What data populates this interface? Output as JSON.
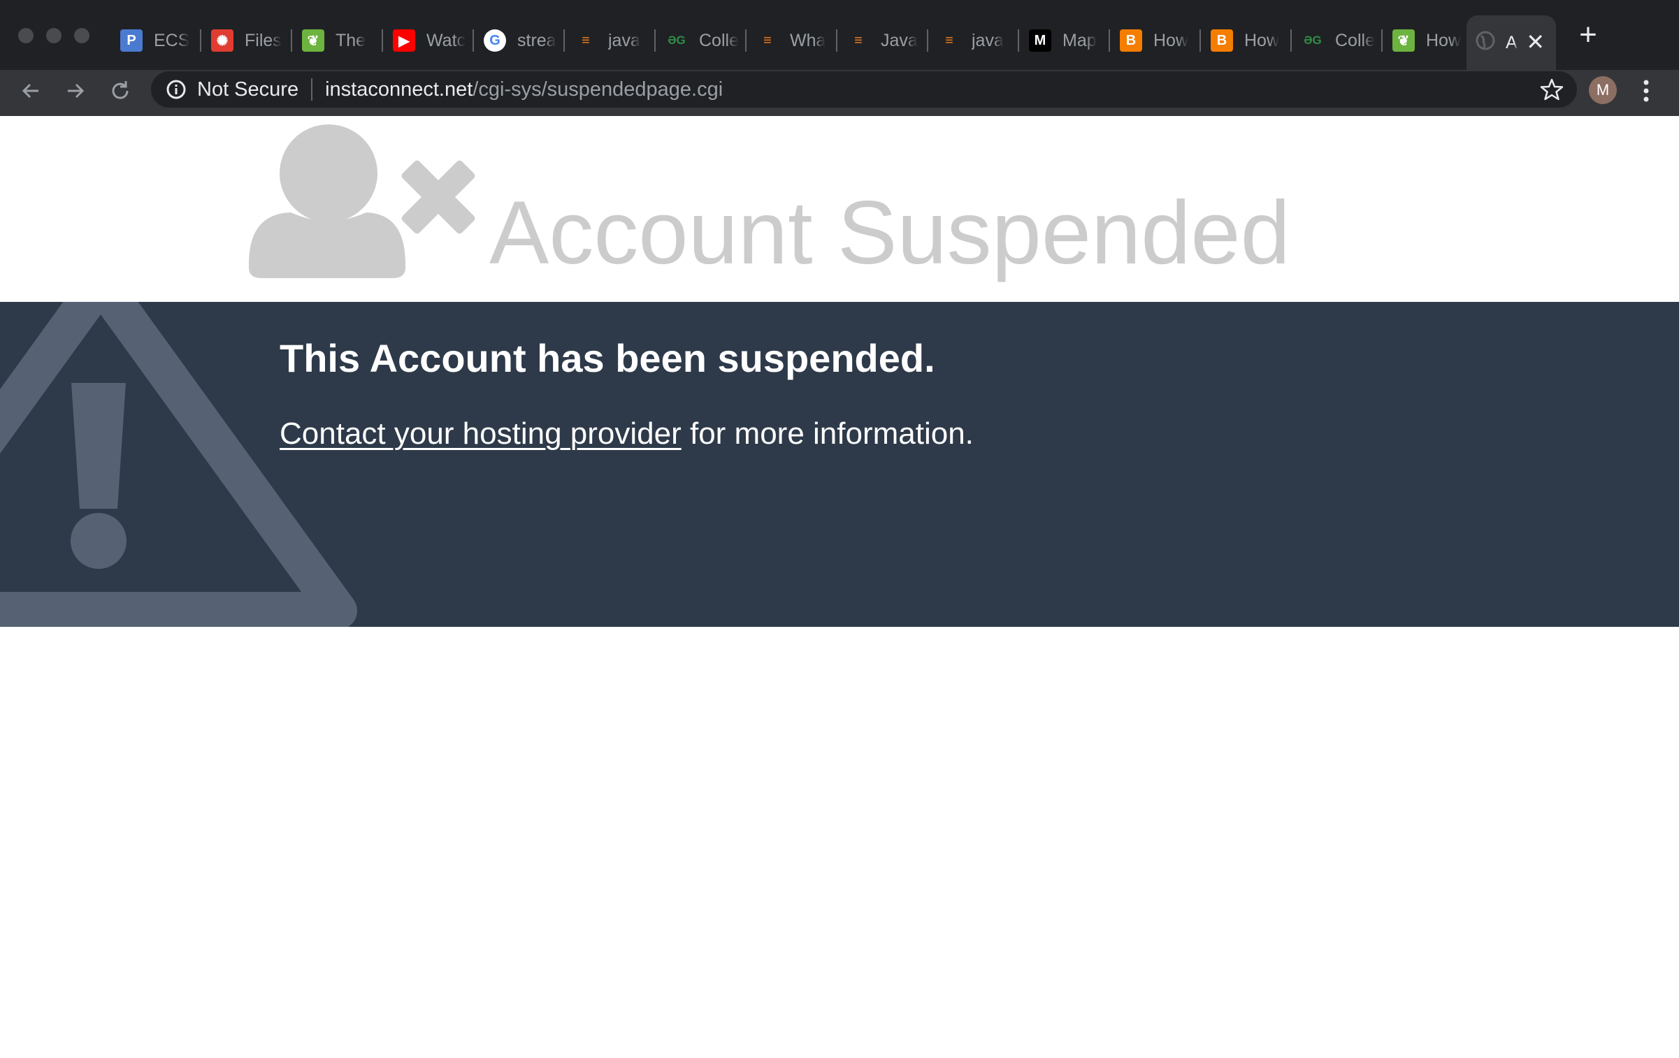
{
  "browser": {
    "tabs": [
      {
        "label": "ECS",
        "icon": "pluralsight-icon",
        "icon_bg": "#4a7bd0",
        "glyph": "P"
      },
      {
        "label": "Files",
        "icon": "canvas-icon",
        "icon_bg": "#e03c31",
        "glyph": "✺"
      },
      {
        "label": "The",
        "icon": "leaf-icon",
        "icon_bg": "#6db33f",
        "glyph": "❦"
      },
      {
        "label": "Watc",
        "icon": "youtube-icon",
        "icon_bg": "#ff0000",
        "glyph": "▶"
      },
      {
        "label": "strea",
        "icon": "google-icon",
        "icon_bg": "#ffffff",
        "glyph": "G"
      },
      {
        "label": "java",
        "icon": "stackoverflow-icon",
        "icon_bg": "transparent",
        "glyph": "≡"
      },
      {
        "label": "Colle",
        "icon": "geeksforgeeks-icon",
        "icon_bg": "transparent",
        "glyph": "ƏG"
      },
      {
        "label": "Wha",
        "icon": "stackoverflow-icon",
        "icon_bg": "transparent",
        "glyph": "≡"
      },
      {
        "label": "Java",
        "icon": "stackoverflow-icon",
        "icon_bg": "transparent",
        "glyph": "≡"
      },
      {
        "label": "java",
        "icon": "stackoverflow-icon",
        "icon_bg": "transparent",
        "glyph": "≡"
      },
      {
        "label": "Map",
        "icon": "medium-icon",
        "icon_bg": "#000000",
        "glyph": "M"
      },
      {
        "label": "How",
        "icon": "blogger-icon",
        "icon_bg": "#f57d00",
        "glyph": "B"
      },
      {
        "label": "How",
        "icon": "blogger-icon",
        "icon_bg": "#f57d00",
        "glyph": "B"
      },
      {
        "label": "Colle",
        "icon": "geeksforgeeks-icon",
        "icon_bg": "transparent",
        "glyph": "ƏG"
      },
      {
        "label": "How",
        "icon": "leaf-icon",
        "icon_bg": "#6db33f",
        "glyph": "❦"
      }
    ],
    "active_tab": {
      "label": "A",
      "icon": "globe-icon"
    },
    "security_label": "Not Secure",
    "url_host": "instaconnect.net",
    "url_path": "/cgi-sys/suspendedpage.cgi",
    "profile_initial": "M"
  },
  "page": {
    "headline": "Account Suspended",
    "banner_title": "This Account has been suspended.",
    "link_text": "Contact your hosting provider",
    "info_suffix": " for more information."
  }
}
